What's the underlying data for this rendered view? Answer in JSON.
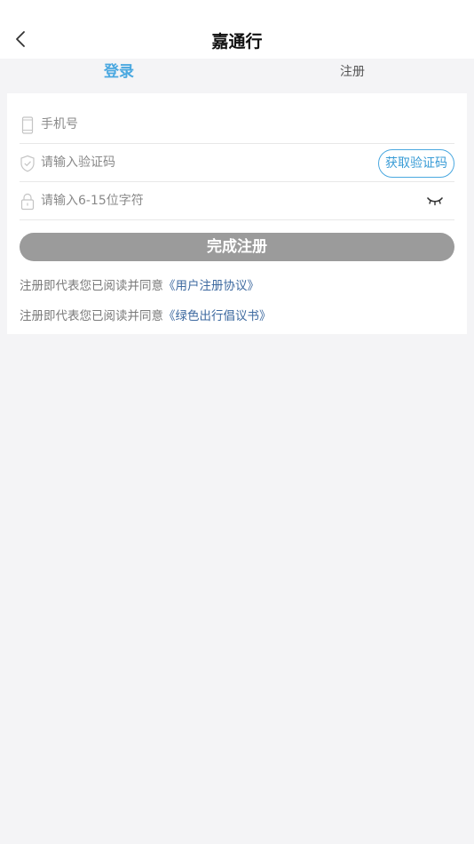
{
  "header": {
    "back_icon": "chevron-left-icon",
    "title": "嘉通行"
  },
  "tabs": [
    {
      "label": "登录",
      "active": true
    },
    {
      "label": "注册",
      "active": false
    }
  ],
  "form": {
    "phone": {
      "placeholder": "手机号",
      "value": "",
      "icon": "phone-icon"
    },
    "code": {
      "placeholder": "请输入验证码",
      "value": "",
      "icon": "shield-icon",
      "button_label": "获取验证码"
    },
    "password": {
      "placeholder": "请输入6-15位字符",
      "value": "",
      "icon": "lock-icon",
      "toggle_icon": "eye-closed-icon"
    },
    "submit_label": "完成注册"
  },
  "agreements": [
    {
      "prefix": "注册即代表您已阅读并同意",
      "link": "《用户注册协议》"
    },
    {
      "prefix": "注册即代表您已阅读并同意",
      "link": "《绿色出行倡议书》"
    }
  ],
  "colors": {
    "accent": "#4aa8e0",
    "link": "#3e6aa0",
    "submit_disabled": "#9b9b9b",
    "background": "#f4f4f6"
  }
}
